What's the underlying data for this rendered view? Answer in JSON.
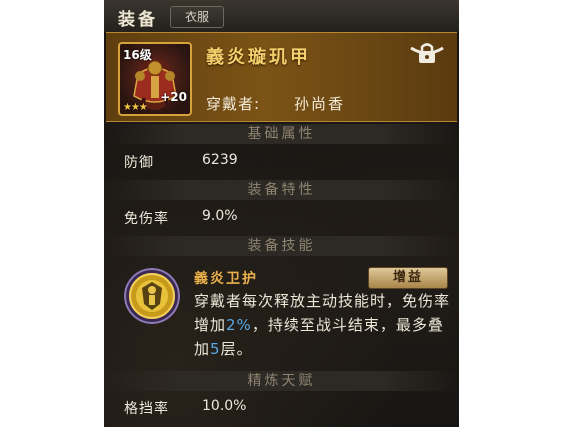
{
  "header": {
    "title": "装备",
    "tab_label": "衣服"
  },
  "item": {
    "level": "16级",
    "enhance": "+20",
    "stars": "★★★",
    "name": "義炎璇玑甲",
    "wearer_label": "穿戴者:",
    "wearer_name": "孙尚香"
  },
  "sections": {
    "base": "基础属性",
    "traits": "装备特性",
    "skill": "装备技能",
    "talent": "精炼天赋"
  },
  "stats": {
    "defense": {
      "label": "防御",
      "value": "6239"
    },
    "damage_reduction": {
      "label": "免伤率",
      "value": "9.0%"
    },
    "block_rate": {
      "label": "格挡率",
      "value": "10.0%"
    }
  },
  "skill": {
    "name": "義炎卫护",
    "tag": "增益",
    "desc_1": "穿戴者每次释放主动技能时，免伤率增加",
    "desc_value1": "2%",
    "desc_2": "，持续至战斗结束，最多叠加",
    "desc_value2": "5",
    "desc_3": "层。"
  },
  "icons": {
    "item": "armor-icon",
    "lock": "lock-icon",
    "skill": "shield-skill-icon"
  },
  "colors": {
    "item_name": "#f4cf6b",
    "skill_name": "#e8b04a",
    "highlight": "#5aa8e6",
    "card_bg": "#7b5316"
  }
}
